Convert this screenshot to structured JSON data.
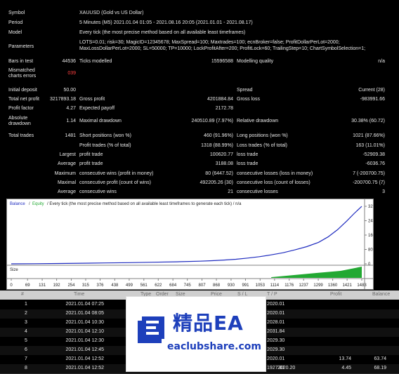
{
  "report": {
    "symbol_label": "Symbol",
    "symbol_value": "XAUUSD (Gold vs US Dollar)",
    "period_label": "Period",
    "period_value": "5 Minutes (M5) 2021.01.04 01:05 - 2021.08.16 20:05 (2021.01.01 - 2021.08.17)",
    "model_label": "Model",
    "model_value": "Every tick (the most precise method based on all available least timeframes)",
    "parameters_label": "Parameters",
    "parameters_line1": "LOTS=0.01; risk=30; MagicID=12345678; MaxSpread=100; Maxtrades=100; ecnBroker=false; ProfitDollarPerLot=2000;",
    "parameters_line2": "MaxLossDollarPerLot=2000; SL=50000; TP=10000; LockProfitAfter=200; ProfitLock=60; TrailingStep=10; ChartSymbolSelection=1;",
    "bars_label": "Bars in test",
    "bars_value": "44536",
    "ticks_label": "Ticks modelled",
    "ticks_value": "15596588",
    "quality_label": "Modelling quality",
    "quality_value": "n/a",
    "mismatched_label_1": "Mismatched",
    "mismatched_label_2": "charts errors",
    "mismatched_value": "039",
    "deposit_label": "Initial deposit",
    "deposit_value": "50.00",
    "spread_label": "Spread",
    "spread_value": "Current (28)",
    "netprofit_label": "Total net profit",
    "netprofit_value": "3217893.18",
    "grossprofit_label": "Gross profit",
    "grossprofit_value": "4201884.84",
    "grossloss_label": "Gross loss",
    "grossloss_value": "-983991.66",
    "pf_label": "Profit factor",
    "pf_value": "4.27",
    "ep_label": "Expected payoff",
    "ep_value": "2172.78",
    "absdd_label_1": "Absolute",
    "absdd_label_2": "drawdown",
    "absdd_value": "1.14",
    "maxdd_label": "Maximal drawdown",
    "maxdd_value": "240510.89 (7.97%)",
    "reldd_label": "Relative drawdown",
    "reldd_value": "30.38% (60.72)",
    "trades_label": "Total trades",
    "trades_value": "1481",
    "short_label": "Short positions (won %)",
    "short_value": "460 (91.96%)",
    "long_label": "Long positions (won %)",
    "long_value": "1021 (87.66%)",
    "pt_label": "Profit trades (% of total)",
    "pt_value": "1318 (88.99%)",
    "lt_label": "Loss trades (% of total)",
    "lt_value": "163 (11.01%)",
    "largest_label": "Largest",
    "largest_profit_label": "profit trade",
    "largest_profit_value": "100620.77",
    "largest_loss_label": "loss trade",
    "largest_loss_value": "-52909.38",
    "average_label": "Average",
    "average_profit_label": "profit trade",
    "average_profit_value": "3188.08",
    "average_loss_label": "loss trade",
    "average_loss_value": "-6036.76",
    "maximum_label": "Maximum",
    "max_wins_label": "consecutive wins (profit in money)",
    "max_wins_value": "80 (6447.52)",
    "max_losses_label": "consecutive losses (loss in money)",
    "max_losses_value": "7 (-200700.75)",
    "maximal_label": "Maximal",
    "maximal_profit_label": "consecutive profit (count of wins)",
    "maximal_profit_value": "492205.26 (30)",
    "maximal_loss_label": "consecutive loss (count of losses)",
    "maximal_loss_value": "-200700.75 (7)",
    "avg2_label": "Average",
    "avg_wins_label": "consecutive wins",
    "avg_wins_value": "21",
    "avg_losses_label": "consecutive losses",
    "avg_losses_value": "3"
  },
  "chart_data": {
    "type": "line",
    "title": "Balance / Equity / Every tick (the most precise method based on all available least timeframes to generate each tick) / n/a",
    "legend": {
      "balance": "Balance",
      "equity": "Equity",
      "rest": " / Every tick (the most precise method based on all available least timeframes to generate each tick) / n/a"
    },
    "x_ticks": [
      "0",
      "69",
      "131",
      "192",
      "254",
      "315",
      "376",
      "438",
      "499",
      "561",
      "622",
      "684",
      "745",
      "807",
      "868",
      "930",
      "991",
      "1053",
      "1114",
      "1176",
      "1237",
      "1299",
      "1360",
      "1421",
      "1483"
    ],
    "y_ticks": [
      "3213374",
      "2410031",
      "1606687",
      "803344",
      "0"
    ],
    "ylim": [
      0,
      3213374
    ],
    "xlim": [
      0,
      1483
    ],
    "series": [
      {
        "name": "Balance",
        "color": "#1e2bbf",
        "x": [
          0,
          100,
          200,
          300,
          400,
          500,
          600,
          700,
          800,
          850,
          900,
          950,
          1000,
          1050,
          1100,
          1150,
          1200,
          1250,
          1300,
          1340,
          1380,
          1420,
          1450,
          1483
        ],
        "y": [
          50,
          8000,
          20000,
          35000,
          50000,
          68000,
          90000,
          115000,
          150000,
          175000,
          210000,
          255000,
          320000,
          400000,
          500000,
          620000,
          780000,
          960000,
          1200000,
          1500000,
          1900000,
          2400000,
          2800000,
          3213374
        ]
      }
    ],
    "size_label": "Size",
    "size_series": {
      "color": "#22a832",
      "x_start": 1100,
      "x_end": 1483
    }
  },
  "table": {
    "headers": [
      "#",
      "Time",
      "Type",
      "Order",
      "Size",
      "Price",
      "S / L",
      "T / P",
      "Profit",
      "Balance"
    ],
    "rows": [
      {
        "n": "1",
        "time": "2021.01.04 07:25",
        "price": "2020.01",
        "profit": "",
        "balance": ""
      },
      {
        "n": "2",
        "time": "2021.01.04 08:05",
        "price": "2020.01",
        "profit": "",
        "balance": ""
      },
      {
        "n": "3",
        "time": "2021.01.04 10:30",
        "price": "2028.01",
        "profit": "",
        "balance": ""
      },
      {
        "n": "4",
        "time": "2021.01.04 12:10",
        "price": "2031.84",
        "profit": "",
        "balance": ""
      },
      {
        "n": "5",
        "time": "2021.01.04 12:30",
        "price": "2029.30",
        "profit": "",
        "balance": ""
      },
      {
        "n": "6",
        "time": "2021.01.04 12:45",
        "price": "2029.30",
        "profit": "",
        "balance": ""
      },
      {
        "n": "7",
        "time": "2021.01.04 12:52",
        "price": "2020.01",
        "profit": "13.74",
        "balance": "63.74"
      },
      {
        "n": "8",
        "time": "2021.01.04 12:52",
        "type": "close",
        "order": "7",
        "size": "0.01",
        "price": "1927.81",
        "sl": "1920.90",
        "price2": "2020.20",
        "profit": "4.45",
        "balance": "68.19"
      }
    ]
  },
  "watermark": {
    "title": "精品EA",
    "url": "eaclubshare.com"
  }
}
